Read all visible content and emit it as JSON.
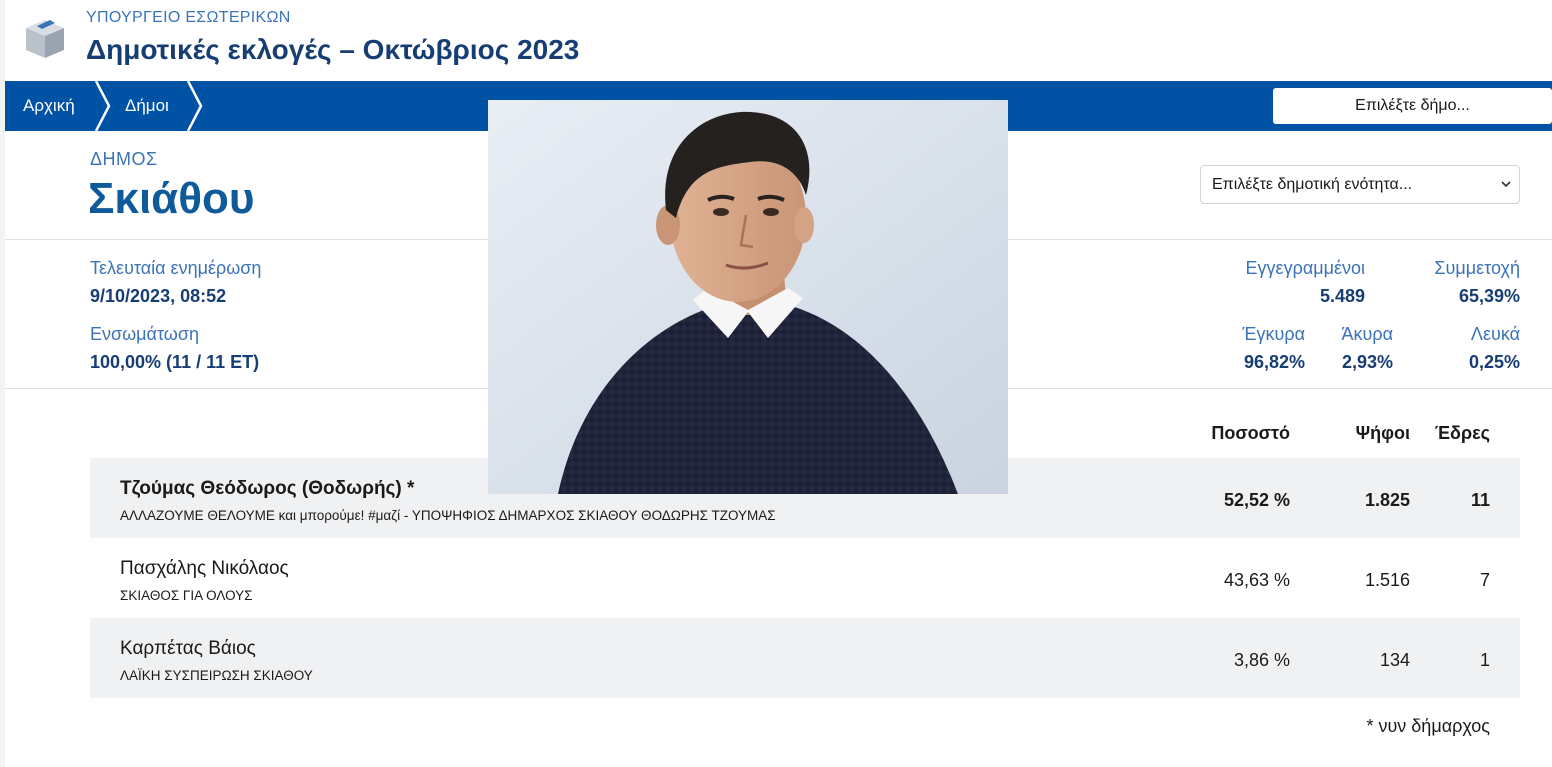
{
  "header": {
    "ministry": "ΥΠΟΥΡΓΕΙΟ ΕΣΩΤΕΡΙΚΩΝ",
    "title": "Δημοτικές εκλογές – Οκτώβριος 2023",
    "logo_icon": "ballot-box-icon"
  },
  "nav": {
    "home": "Αρχική",
    "municipalities": "Δήμοι",
    "select_municipality": "Επιλέξτε δήμο...",
    "background_color": "#0052a5"
  },
  "municipality": {
    "label": "ΔΗΜΟΣ",
    "name": "Σκιάθου",
    "unit_select": "Επιλέξτε δημοτική ενότητα..."
  },
  "stats": {
    "last_update_label": "Τελευταία ενημέρωση",
    "last_update_value": "9/10/2023, 08:52",
    "integration_label": "Ενσωμάτωση",
    "integration_value": "100,00% (11 / 11 ΕΤ)",
    "registered_label": "Εγγεγραμμένοι",
    "registered_value": "5.489",
    "turnout_label": "Συμμετοχή",
    "turnout_value": "65,39%",
    "valid_label": "Έγκυρα",
    "valid_value": "96,82%",
    "invalid_label": "Άκυρα",
    "invalid_value": "2,93%",
    "blank_label": "Λευκά",
    "blank_value": "0,25%"
  },
  "table": {
    "headers": {
      "percent": "Ποσοστό",
      "votes": "Ψήφοι",
      "seats": "Έδρες"
    },
    "rows": [
      {
        "candidate": "Τζούμας Θεόδωρος (Θοδωρής)  *",
        "party": "ΑΛΛΑΖΟΥΜΕ ΘΕΛΟΥΜΕ και μπορούμε! #μαζί - ΥΠΟΨΗΦΙΟΣ ΔΗΜΑΡΧΟΣ ΣΚΙΑΘΟΥ ΘΟΔΩΡΗΣ ΤΖΟΥΜΑΣ",
        "percent": "52,52 %",
        "votes": "1.825",
        "seats": "11"
      },
      {
        "candidate": "Πασχάλης Νικόλαος",
        "party": "ΣΚΙΑΘΟΣ ΓΙΑ ΟΛΟΥΣ",
        "percent": "43,63 %",
        "votes": "1.516",
        "seats": "7"
      },
      {
        "candidate": "Καρπέτας Βάιος",
        "party": "ΛΑΪΚΗ ΣΥΣΠΕΙΡΩΣΗ ΣΚΙΑΘΟΥ",
        "percent": "3,86 %",
        "votes": "134",
        "seats": "1"
      }
    ],
    "footnote": "* νυν δήμαρχος"
  }
}
